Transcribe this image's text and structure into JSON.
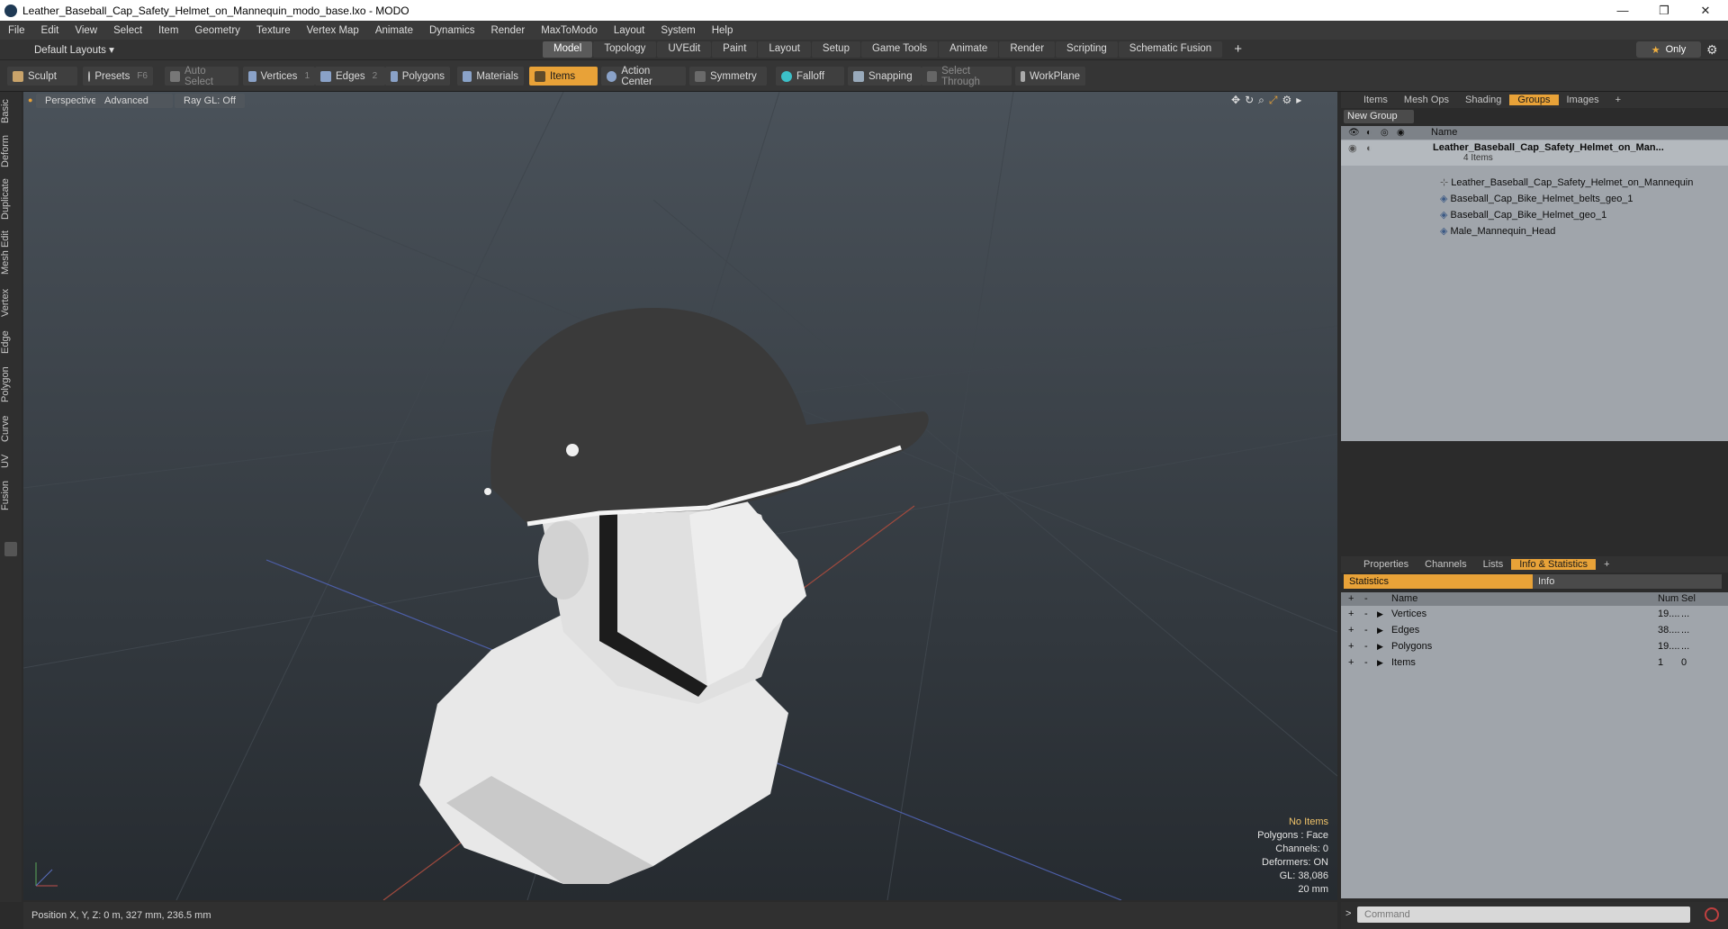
{
  "window": {
    "title": "Leather_Baseball_Cap_Safety_Helmet_on_Mannequin_modo_base.lxo - MODO",
    "minimize": "—",
    "restore": "❐",
    "close": "✕"
  },
  "menu": [
    "File",
    "Edit",
    "View",
    "Select",
    "Item",
    "Geometry",
    "Texture",
    "Vertex Map",
    "Animate",
    "Dynamics",
    "Render",
    "MaxToModo",
    "Layout",
    "System",
    "Help"
  ],
  "layouts": {
    "selector": "Default Layouts ▾",
    "tabs": [
      "Model",
      "Topology",
      "UVEdit",
      "Paint",
      "Layout",
      "Setup",
      "Game Tools",
      "Animate",
      "Render",
      "Scripting",
      "Schematic Fusion"
    ],
    "active": "Model",
    "add": "+",
    "only": "Only"
  },
  "toolbar": {
    "sculpt": "Sculpt",
    "presets": "Presets",
    "presets_key": "F6",
    "auto_select": "Auto Select",
    "vertices": "Vertices",
    "vertices_num": "1",
    "edges": "Edges",
    "edges_num": "2",
    "polygons": "Polygons",
    "materials": "Materials",
    "items": "Items",
    "action_center": "Action Center",
    "symmetry": "Symmetry",
    "falloff": "Falloff",
    "snapping": "Snapping",
    "select_through": "Select Through",
    "workplane": "WorkPlane"
  },
  "left_tabs": [
    "Basic",
    "Deform",
    "Duplicate",
    "Mesh Edit",
    "Vertex",
    "Edge",
    "Polygon",
    "Curve",
    "UV",
    "Fusion"
  ],
  "viewport": {
    "perspective": "Perspective",
    "advanced": "Advanced",
    "raygl": "Ray GL: Off",
    "hud": {
      "no_items": "No Items",
      "polygons": "Polygons : Face",
      "channels": "Channels: 0",
      "deformers": "Deformers: ON",
      "gl": "GL: 38,086",
      "scale": "20 mm"
    }
  },
  "status": {
    "position": "Position X, Y, Z:  0 m, 327 mm, 236.5 mm"
  },
  "groups_panel": {
    "tabs": [
      "Items",
      "Mesh Ops",
      "Shading",
      "Groups",
      "Images"
    ],
    "active": "Groups",
    "new_group": "New Group",
    "col_name": "Name",
    "root": "Leather_Baseball_Cap_Safety_Helmet_on_Man...",
    "root_count": "4 Items",
    "children": [
      "Leather_Baseball_Cap_Safety_Helmet_on_Mannequin",
      "Baseball_Cap_Bike_Helmet_belts_geo_1",
      "Baseball_Cap_Bike_Helmet_geo_1",
      "Male_Mannequin_Head"
    ]
  },
  "info_panel": {
    "tabs": [
      "Properties",
      "Channels",
      "Lists",
      "Info & Statistics"
    ],
    "active": "Info & Statistics",
    "statistics": "Statistics",
    "info": "Info",
    "cols": {
      "name": "Name",
      "num": "Num",
      "sel": "Sel"
    },
    "rows": [
      {
        "name": "Vertices",
        "num": "19....",
        "sel": "..."
      },
      {
        "name": "Edges",
        "num": "38....",
        "sel": "..."
      },
      {
        "name": "Polygons",
        "num": "19....",
        "sel": "..."
      },
      {
        "name": "Items",
        "num": "1",
        "sel": "0"
      }
    ]
  },
  "command": {
    "placeholder": "Command",
    "prompt": ">"
  }
}
